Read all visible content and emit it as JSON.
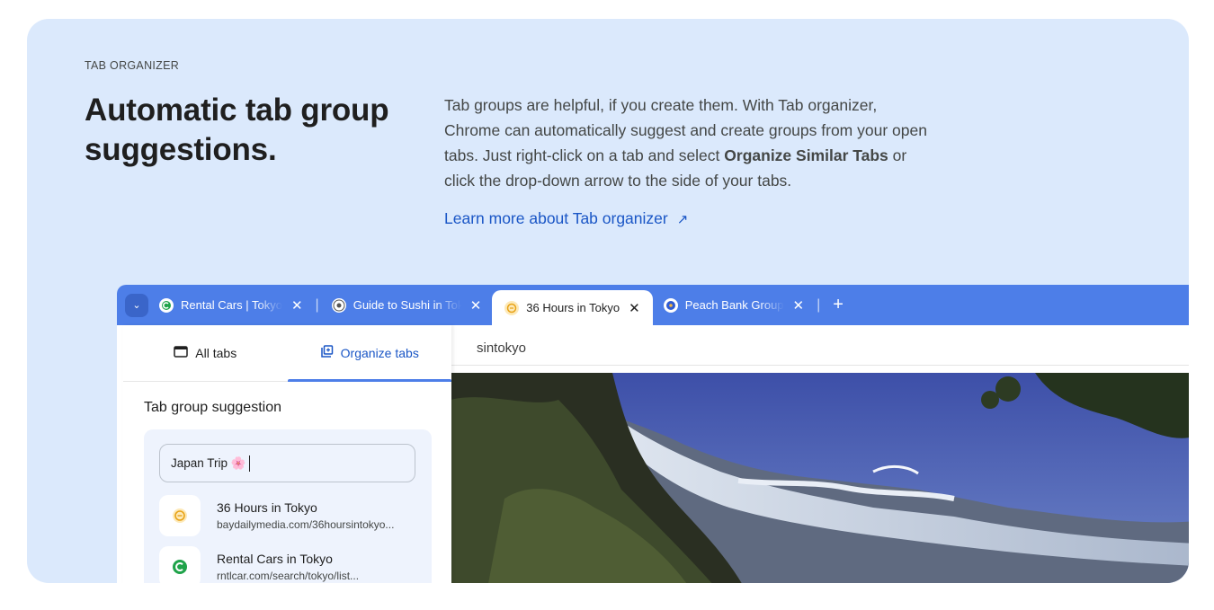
{
  "eyebrow": "TAB ORGANIZER",
  "headline": "Automatic tab group suggestions.",
  "description": {
    "part1": "Tab groups are helpful, if you create them. With Tab organizer, Chrome can automatically suggest and create groups from your open tabs. Just right-click on a tab and select ",
    "bold1": "Organize Similar Tabs",
    "part2": " or click the drop-down arrow to the side of your tabs."
  },
  "learn_more": {
    "label": "Learn more about Tab organizer",
    "icon": "external-arrow-icon"
  },
  "browser": {
    "tab_search_icon": "chevron-down-icon",
    "tabs": [
      {
        "title": "Rental Cars | Tokyo",
        "close": "✕",
        "icon": "rental-cars-favicon",
        "active": false
      },
      {
        "title": "Guide to Sushi in Tokyo",
        "close": "✕",
        "icon": "sushi-guide-favicon",
        "active": false
      },
      {
        "title": "36 Hours in Tokyo",
        "close": "✕",
        "icon": "bay-daily-favicon",
        "active": true
      },
      {
        "title": "Peach Bank Group",
        "close": "✕",
        "icon": "peach-bank-favicon",
        "active": false
      }
    ],
    "new_tab": "+",
    "omnibox_text": "sintokyo",
    "colors": {
      "tabstrip": "#4d7ee8",
      "accent": "#1a56c6",
      "card_bg": "#dbe9fc"
    }
  },
  "panel": {
    "tabs": [
      {
        "label": "All tabs",
        "icon": "tab-window-icon"
      },
      {
        "label": "Organize tabs",
        "icon": "organize-tabs-icon"
      }
    ],
    "suggestion_title": "Tab group suggestion",
    "group_name": "Japan Trip 🌸",
    "items": [
      {
        "title": "36 Hours in Tokyo",
        "url": "baydailymedia.com/36hoursintokyo...",
        "icon": "bay-daily-favicon"
      },
      {
        "title": "Rental Cars in Tokyo",
        "url": "rntlcar.com/search/tokyo/list...",
        "icon": "rental-cars-favicon"
      }
    ]
  }
}
